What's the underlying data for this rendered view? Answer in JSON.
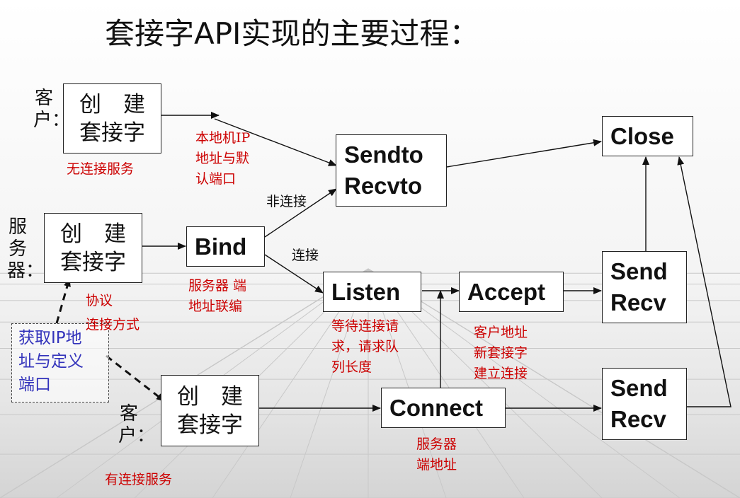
{
  "title": "套接字API实现的主要过程：",
  "client_top": {
    "role_label": "客户：",
    "box": [
      "创　建",
      "套接字"
    ],
    "note": "无连接服务"
  },
  "server": {
    "role_label": "服务器：",
    "box": [
      "创　建",
      "套接字"
    ],
    "note": [
      "协议",
      "连接方式"
    ]
  },
  "client_bottom": {
    "role_label": "客户：",
    "box": [
      "创　建",
      "套接字"
    ],
    "note": "有连接服务"
  },
  "get_ip": [
    "获取IP地",
    "址与定义",
    "端口"
  ],
  "local_ip_note": [
    "本地机IP",
    "地址与默",
    "认端口"
  ],
  "bind": {
    "label": "Bind",
    "note": [
      "服务器 端",
      "地址联编"
    ]
  },
  "edge_labels": {
    "connectionless": "非连接",
    "connection": "连接"
  },
  "sendto": [
    "Sendto",
    "Recvto"
  ],
  "close": "Close",
  "listen": {
    "label": "Listen",
    "note": [
      "等待连接请",
      "求，请求队",
      "列长度"
    ]
  },
  "accept": {
    "label": "Accept",
    "note": [
      "客户地址",
      "新套接字",
      "建立连接"
    ]
  },
  "connect": {
    "label": "Connect",
    "note": [
      "服务器",
      "端地址"
    ]
  },
  "send_recv_upper": [
    "Send",
    "Recv"
  ],
  "send_recv_lower": [
    "Send",
    "Recv"
  ],
  "colors": {
    "note_red": "#cc0000",
    "ip_blue": "#3333bb",
    "line": "#111111"
  }
}
